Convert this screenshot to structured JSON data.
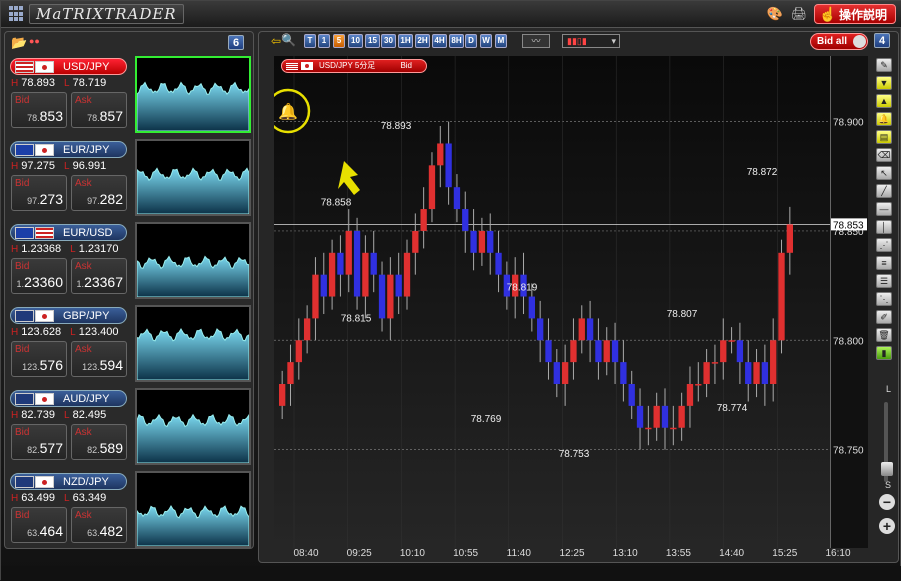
{
  "app": {
    "logo_text": "MaTRIXTRADER",
    "help_label": "操作説明"
  },
  "watchlist": {
    "badge": "6",
    "pairs": [
      {
        "pair": "USD/JPY",
        "flag1": "us",
        "flag2": "jp",
        "high": "78.893",
        "low": "78.719",
        "bid_label": "Bid",
        "ask_label": "Ask",
        "bid_prefix": "78.",
        "bid_main": "853",
        "ask_prefix": "78.",
        "ask_main": "857",
        "selected": true
      },
      {
        "pair": "EUR/JPY",
        "flag1": "eu",
        "flag2": "jp",
        "high": "97.275",
        "low": "96.991",
        "bid_label": "Bid",
        "ask_label": "Ask",
        "bid_prefix": "97.",
        "bid_main": "273",
        "ask_prefix": "97.",
        "ask_main": "282",
        "selected": false
      },
      {
        "pair": "EUR/USD",
        "flag1": "eu",
        "flag2": "us",
        "high": "1.23368",
        "low": "1.23170",
        "bid_label": "Bid",
        "ask_label": "Ask",
        "bid_prefix": "1.",
        "bid_main": "23360",
        "ask_prefix": "1.",
        "ask_main": "23367",
        "selected": false
      },
      {
        "pair": "GBP/JPY",
        "flag1": "gb",
        "flag2": "jp",
        "high": "123.628",
        "low": "123.400",
        "bid_label": "Bid",
        "ask_label": "Ask",
        "bid_prefix": "123.",
        "bid_main": "576",
        "ask_prefix": "123.",
        "ask_main": "594",
        "selected": false
      },
      {
        "pair": "AUD/JPY",
        "flag1": "au",
        "flag2": "jp",
        "high": "82.739",
        "low": "82.495",
        "bid_label": "Bid",
        "ask_label": "Ask",
        "bid_prefix": "82.",
        "bid_main": "577",
        "ask_prefix": "82.",
        "ask_main": "589",
        "selected": false
      },
      {
        "pair": "NZD/JPY",
        "flag1": "nz",
        "flag2": "jp",
        "high": "63.499",
        "low": "63.349",
        "bid_label": "Bid",
        "ask_label": "Ask",
        "bid_prefix": "63.",
        "bid_main": "464",
        "ask_prefix": "63.",
        "ask_main": "482",
        "selected": false
      }
    ],
    "hl_labels": {
      "high": "H",
      "low": "L"
    }
  },
  "chart_panel": {
    "badge": "4",
    "bid_all_label": "Bid all",
    "timeframes": [
      "T",
      "1",
      "5",
      "10",
      "15",
      "30",
      "1H",
      "2H",
      "4H",
      "8H",
      "D",
      "W",
      "M"
    ],
    "active_timeframe": "5",
    "chart_label": "USD/JPY 5分足",
    "chart_side": "Bid",
    "current_price": "78.853",
    "right_tools": {
      "l": "L",
      "s": "S",
      "plus": "+",
      "minus": "−"
    }
  },
  "chart_data": {
    "type": "candlestick",
    "title": "USD/JPY 5分足",
    "y_ticks": [
      "78.900",
      "78.850",
      "78.800",
      "78.750"
    ],
    "ylim": [
      78.705,
      78.93
    ],
    "x_ticks": [
      "08:40",
      "09:25",
      "10:10",
      "10:55",
      "11:40",
      "12:25",
      "13:10",
      "13:55",
      "14:40",
      "15:25",
      "16:10"
    ],
    "annotations": [
      {
        "label": "78.893",
        "value": 78.893,
        "kind": "high"
      },
      {
        "label": "78.858",
        "value": 78.858,
        "kind": "high"
      },
      {
        "label": "78.815",
        "value": 78.815,
        "kind": "low"
      },
      {
        "label": "78.819",
        "value": 78.819,
        "kind": "high"
      },
      {
        "label": "78.769",
        "value": 78.769,
        "kind": "low"
      },
      {
        "label": "78.753",
        "value": 78.753,
        "kind": "low"
      },
      {
        "label": "78.807",
        "value": 78.807,
        "kind": "high"
      },
      {
        "label": "78.774",
        "value": 78.774,
        "kind": "low"
      },
      {
        "label": "78.872",
        "value": 78.872,
        "kind": "high"
      }
    ],
    "closes": [
      78.78,
      78.79,
      78.8,
      78.81,
      78.83,
      78.82,
      78.84,
      78.83,
      78.85,
      78.82,
      78.84,
      78.83,
      78.81,
      78.83,
      78.82,
      78.84,
      78.85,
      78.86,
      78.88,
      78.89,
      78.87,
      78.86,
      78.85,
      78.84,
      78.85,
      78.84,
      78.83,
      78.82,
      78.83,
      78.82,
      78.81,
      78.8,
      78.79,
      78.78,
      78.79,
      78.8,
      78.81,
      78.8,
      78.79,
      78.8,
      78.79,
      78.78,
      78.77,
      78.76,
      78.76,
      78.77,
      78.76,
      78.76,
      78.77,
      78.78,
      78.78,
      78.79,
      78.79,
      78.8,
      78.8,
      78.79,
      78.78,
      78.79,
      78.78,
      78.8,
      78.84,
      78.853
    ]
  },
  "colors": {
    "up": "#e03030",
    "down": "#3030e0",
    "accent": "#e8e000"
  }
}
